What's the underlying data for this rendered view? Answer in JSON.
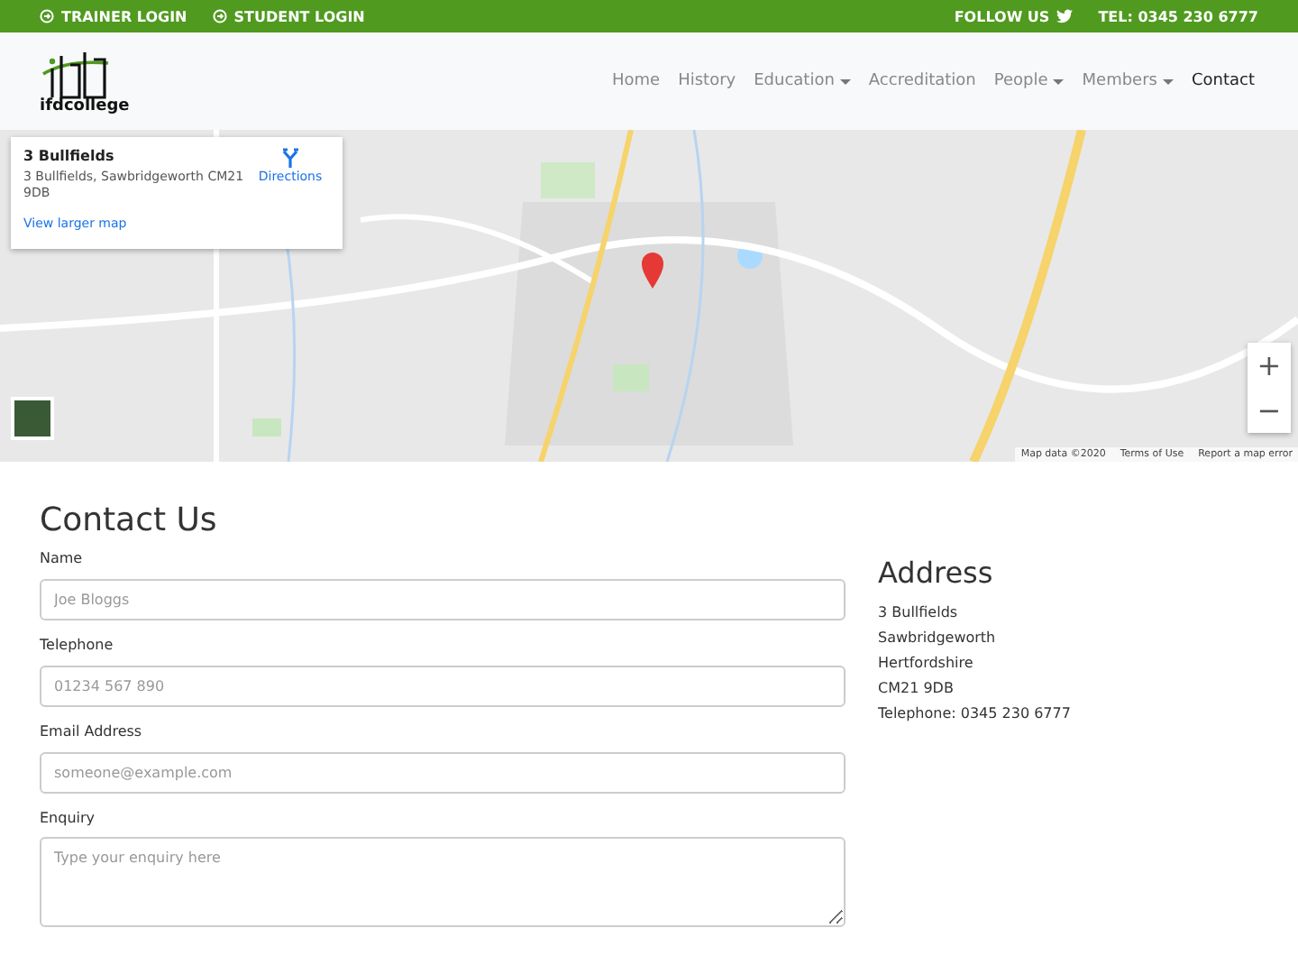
{
  "top_bar": {
    "links": [
      {
        "label": "TRAINER LOGIN"
      },
      {
        "label": "STUDENT LOGIN"
      }
    ],
    "follow": "FOLLOW US",
    "phone": "TEL: 0345 230 6777"
  },
  "header": {
    "logo": "ifdcollege",
    "nav": [
      {
        "label": "Home",
        "selected": false,
        "dropdown": false
      },
      {
        "label": "History",
        "selected": false,
        "dropdown": false
      },
      {
        "label": "Education",
        "selected": false,
        "dropdown": true
      },
      {
        "label": "Accreditation",
        "selected": false,
        "dropdown": false
      },
      {
        "label": "People",
        "selected": false,
        "dropdown": true
      },
      {
        "label": "Members",
        "selected": false,
        "dropdown": true
      },
      {
        "label": "Contact",
        "selected": true,
        "dropdown": false
      }
    ]
  },
  "map": {
    "kind": "picture",
    "card": {
      "title": "3 Bullfields",
      "address": "3 Bullfields, Sawbridgeworth CM21 9DB",
      "directions": "Directions",
      "larger": "View larger map"
    },
    "zoom": [
      "+",
      "−"
    ],
    "attribution": [
      "Map data ©2020",
      "Terms of Use",
      "Report a map error"
    ]
  },
  "contact": {
    "title": "Contact Us",
    "fields": [
      {
        "label": "Name",
        "placeholder": "Joe Bloggs",
        "kind": "input"
      },
      {
        "label": "Telephone",
        "placeholder": "01234 567 890",
        "kind": "input"
      },
      {
        "label": "Email Address",
        "placeholder": "someone@example.com",
        "kind": "input"
      },
      {
        "label": "Enquiry",
        "placeholder": "Type your enquiry here",
        "kind": "textarea"
      }
    ]
  },
  "address": {
    "title": "Address",
    "lines": [
      "3 Bullfields",
      "Sawbridgeworth",
      "Hertfordshire",
      "CM21 9DB",
      "Telephone: 0345 230 6777"
    ]
  }
}
